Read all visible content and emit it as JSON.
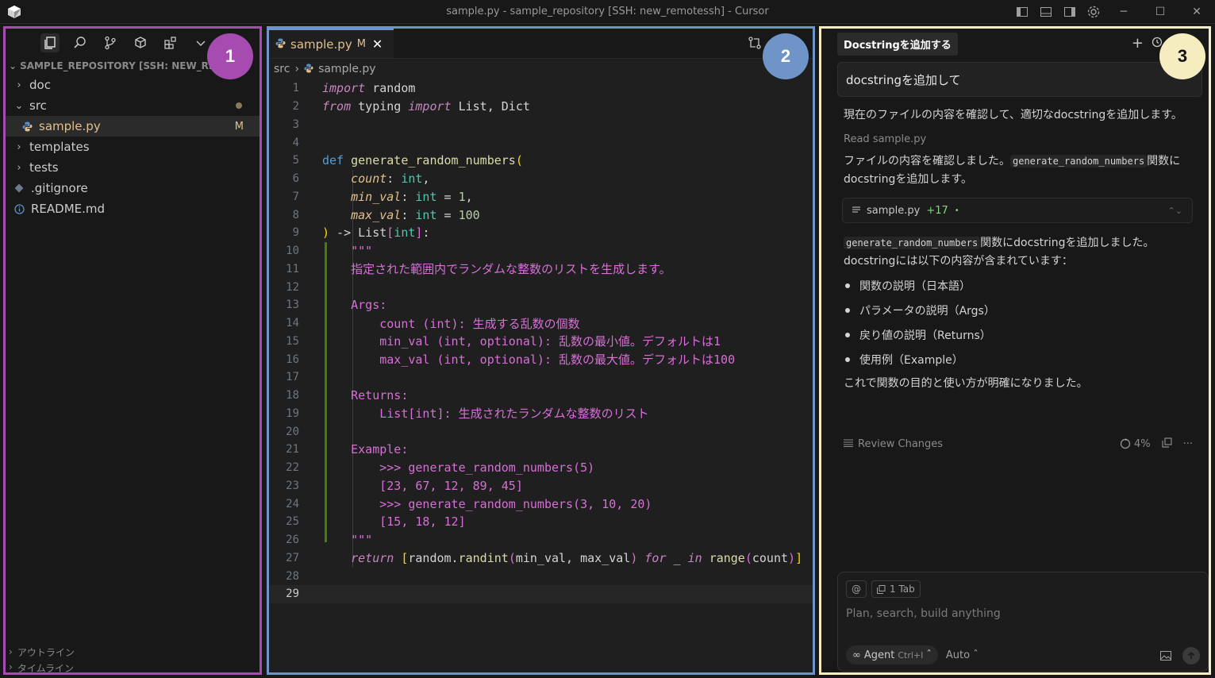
{
  "window": {
    "title": "sample.py - sample_repository [SSH: new_remotessh] - Cursor"
  },
  "sidebar": {
    "badge": "1",
    "root_label": "SAMPLE_REPOSITORY [SSH: NEW_REMO",
    "items": [
      {
        "label": "doc",
        "type": "folder"
      },
      {
        "label": "src",
        "type": "folder-open"
      },
      {
        "label": "sample.py",
        "type": "file",
        "status": "M"
      },
      {
        "label": "templates",
        "type": "folder"
      },
      {
        "label": "tests",
        "type": "folder"
      },
      {
        "label": ".gitignore",
        "type": "file"
      },
      {
        "label": "README.md",
        "type": "file"
      }
    ],
    "outline_label": "アウトライン",
    "timeline_label": "タイムライン"
  },
  "editor": {
    "badge": "2",
    "tab": {
      "label": "sample.py",
      "status": "M",
      "close": "✕"
    },
    "breadcrumb": {
      "folder": "src",
      "separator": "›",
      "file": "sample.py"
    },
    "current_line": 29
  },
  "chat": {
    "badge": "3",
    "tab_title": "Docstringを追加する",
    "user_message": "docstringを追加して",
    "assistant_intro": "現在のファイルの内容を確認して、適切なdocstringを追加します。",
    "read_label": "Read",
    "read_file": "sample.py",
    "confirm_prefix": "ファイルの内容を確認しました。",
    "confirm_code": "generate_random_numbers",
    "confirm_suffix": "関数に",
    "confirm_line2": "docstringを追加します。",
    "file_card": {
      "name": "sample.py",
      "diff": "+17",
      "dot": "•"
    },
    "result_code": "generate_random_numbers",
    "result_suffix": "関数にdocstringを追加しました。",
    "result_line2": "docstringには以下の内容が含まれています：",
    "bullets": [
      "関数の説明（日本語）",
      "パラメータの説明（Args）",
      "戻り値の説明（Returns）",
      "使用例（Example）"
    ],
    "closing": "これで関数の目的と使い方が明確になりました。",
    "review_label": "Review Changes",
    "progress": "4%",
    "composer": {
      "at": "@",
      "tab_chip": "1 Tab",
      "placeholder": "Plan, search, build anything",
      "agent_label": "Agent",
      "agent_shortcut": "Ctrl+I",
      "model_label": "Auto"
    }
  }
}
